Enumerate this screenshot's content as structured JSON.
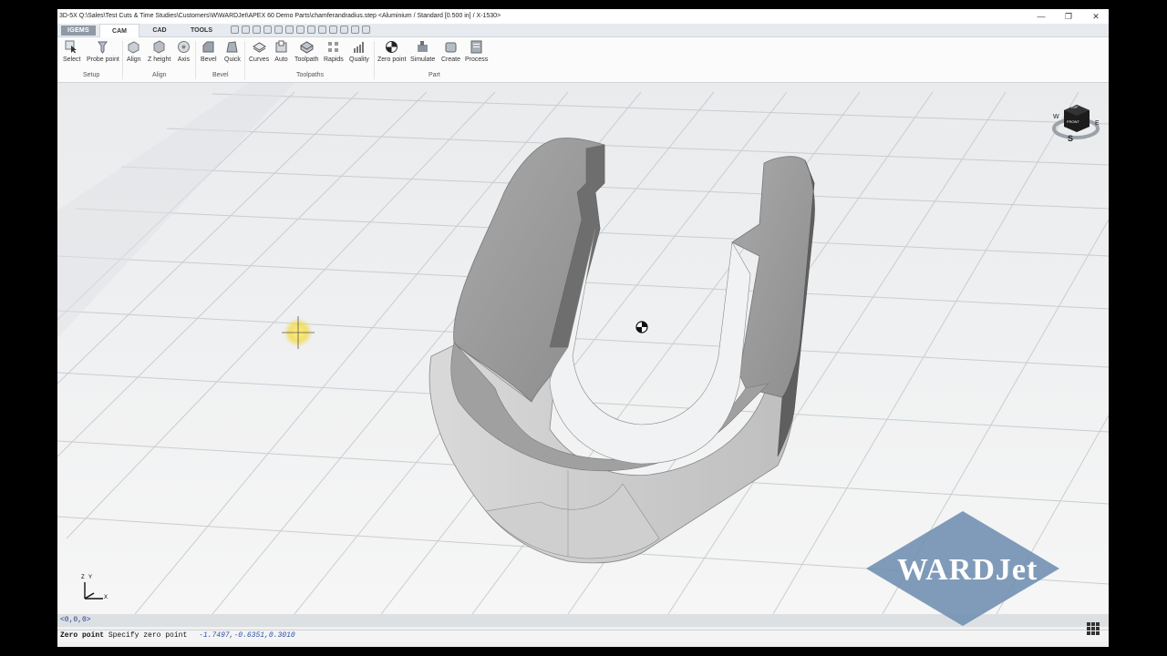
{
  "window": {
    "title": "3D-5X  Q:\\Sales\\Test Cuts & Time Studies\\Customers\\W\\WARDJet\\APEX 60 Demo Parts\\chamferandradius.step  <Aluminium / Standard [0.500 in] / X-1530>",
    "minimize": "—",
    "restore": "❐",
    "close": "✕"
  },
  "app": {
    "logo": "IGEMS"
  },
  "tabs": [
    {
      "label": "CAM",
      "active": true
    },
    {
      "label": "CAD",
      "active": false
    },
    {
      "label": "TOOLS",
      "active": false
    }
  ],
  "ribbon": {
    "groups": [
      {
        "label": "Setup",
        "buttons": [
          {
            "label": "Select",
            "icon": "select-cursor-icon"
          },
          {
            "label": "Probe point",
            "icon": "probe-point-icon"
          }
        ]
      },
      {
        "label": "Align",
        "buttons": [
          {
            "label": "Align",
            "icon": "align-icon"
          },
          {
            "label": "Z height",
            "icon": "z-height-icon"
          },
          {
            "label": "Axis",
            "icon": "axis-icon"
          }
        ]
      },
      {
        "label": "Bevel",
        "buttons": [
          {
            "label": "Bevel",
            "icon": "bevel-icon"
          },
          {
            "label": "Quick",
            "icon": "quick-bevel-icon"
          }
        ]
      },
      {
        "label": "Toolpaths",
        "buttons": [
          {
            "label": "Curves",
            "icon": "curves-icon"
          },
          {
            "label": "Auto",
            "icon": "auto-toolpath-icon"
          },
          {
            "label": "Toolpath",
            "icon": "toolpath-icon"
          },
          {
            "label": "Rapids",
            "icon": "rapids-icon"
          },
          {
            "label": "Quality",
            "icon": "quality-icon"
          }
        ]
      },
      {
        "label": "Part",
        "buttons": [
          {
            "label": "Zero point",
            "icon": "zero-point-icon"
          },
          {
            "label": "Simulate",
            "icon": "simulate-icon"
          },
          {
            "label": "Create",
            "icon": "create-icon"
          },
          {
            "label": "Process",
            "icon": "process-icon"
          }
        ]
      }
    ]
  },
  "viewport": {
    "view_cube": {
      "top": "TOP",
      "front": "FRONT",
      "west": "W",
      "east": "E",
      "south": "S"
    },
    "axis_triad": {
      "z": "Z",
      "y": "Y",
      "x": "X"
    }
  },
  "watermark": {
    "brand": "WARDJet"
  },
  "status": {
    "coordinate_readout": "<0,0,0>",
    "command": "Zero point",
    "prompt": "Specify zero point",
    "coords": "-1.7497,-0.6351,0.3010"
  }
}
